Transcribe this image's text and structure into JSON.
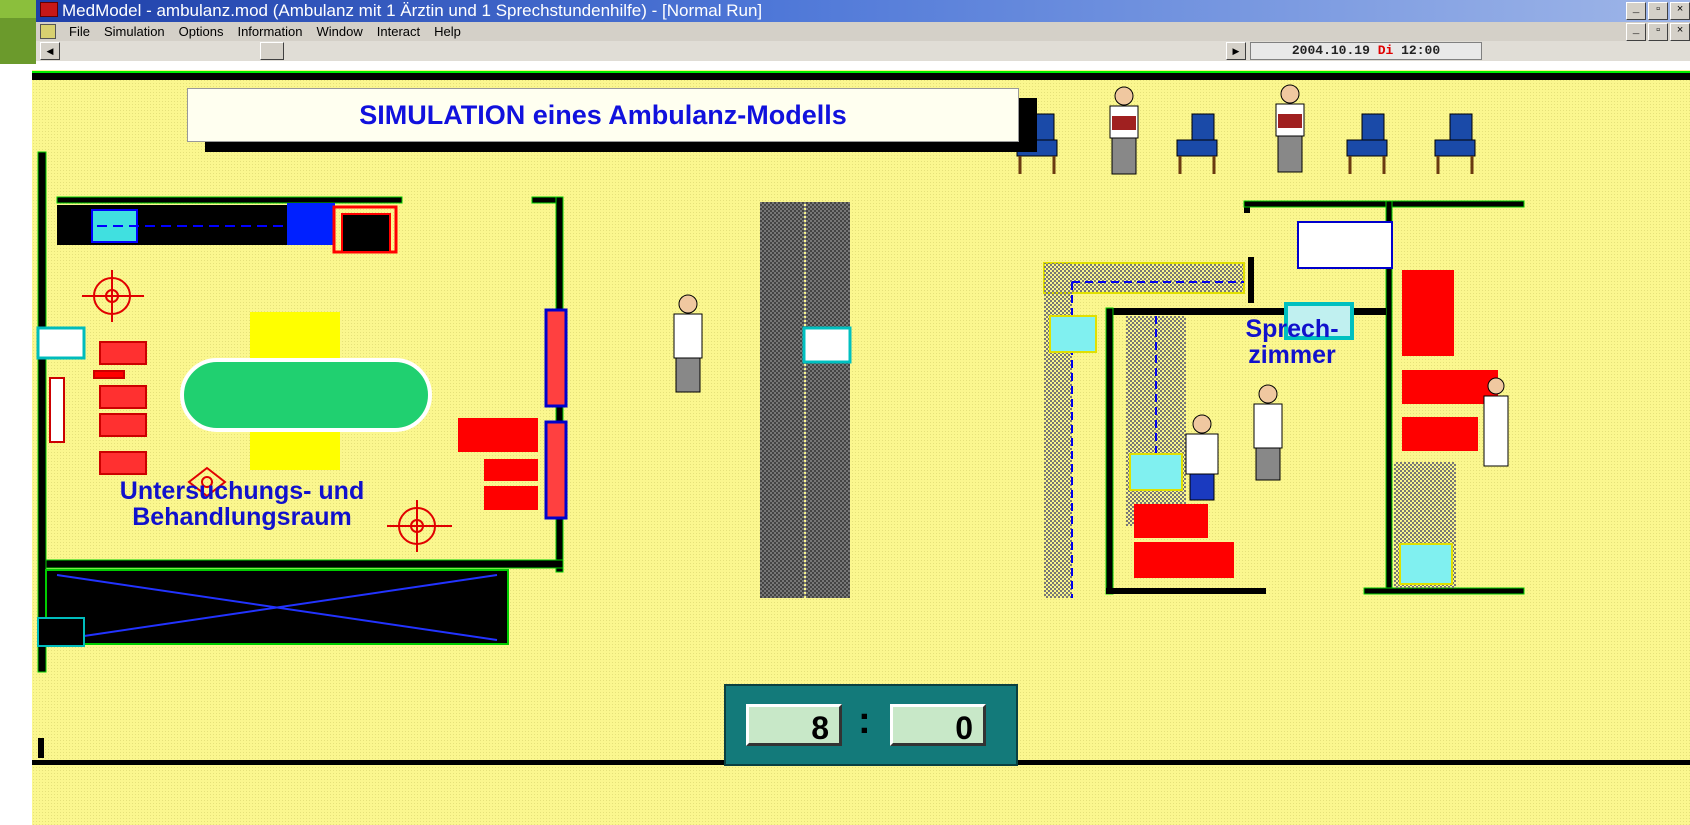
{
  "window": {
    "title": "MedModel - ambulanz.mod (Ambulanz mit 1 Ärztin und 1 Sprechstundenhilfe) - [Normal Run]",
    "controls": [
      "_",
      "▫",
      "×"
    ]
  },
  "menu": {
    "items": [
      "File",
      "Simulation",
      "Options",
      "Information",
      "Window",
      "Interact",
      "Help"
    ]
  },
  "status": {
    "date": "2004.10.19",
    "weekday": "Di",
    "time": "12:00"
  },
  "banner": {
    "title": "SIMULATION eines Ambulanz-Modells"
  },
  "rooms": {
    "treatment_line1": "Untersuchungs- und",
    "treatment_line2": "Behandlungsraum",
    "consult_line1": "Sprech-",
    "consult_line2": "zimmer"
  },
  "clock": {
    "hours": "8",
    "separator": ":",
    "minutes": "0"
  },
  "colors": {
    "floor": "#fbf78f",
    "wall": "#000000",
    "accent_blue": "#1111dd",
    "equipment_red": "#ff0000",
    "clock_bg": "#137a7a"
  },
  "icons": {
    "app": "medmodel-app-icon",
    "doc": "document-icon",
    "scroll_left": "arrow-left-icon",
    "scroll_right": "arrow-right-icon"
  }
}
